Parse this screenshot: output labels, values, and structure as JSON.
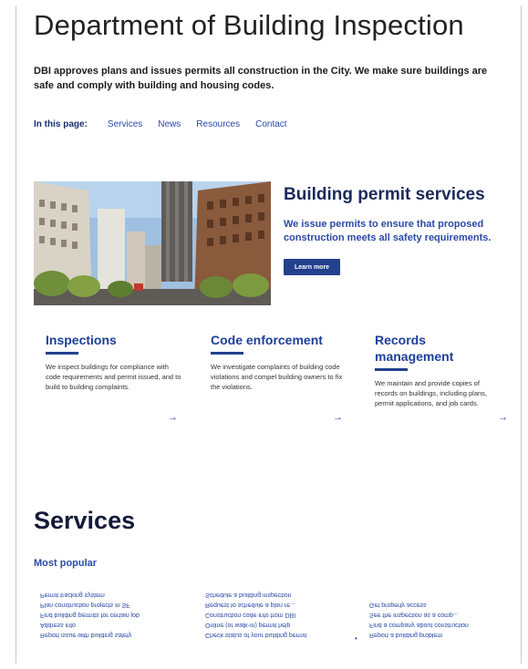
{
  "header": {
    "title": "Department of Building Inspection",
    "intro": "DBI approves plans and issues permits all construction in the City. We make sure buildings are safe and comply with building and housing codes."
  },
  "in_page": {
    "label": "In this page:",
    "links": [
      "Services",
      "News",
      "Resources",
      "Contact"
    ]
  },
  "hero": {
    "title": "Building permit services",
    "text": "We issue permits to ensure that proposed construction meets all safety requirements.",
    "button": "Learn more"
  },
  "cards": [
    {
      "title": "Inspections",
      "text": "We inspect buildings for compliance with code requirements and permit issued, and to build to building complaints.",
      "arrow": "→"
    },
    {
      "title": "Code enforcement",
      "text": "We investigate complaints of building code violations and compel building owners to fix the violations.",
      "arrow": "→"
    },
    {
      "title": "Records management",
      "text": "We maintain and provide copies of records on buildings, including plans, permit applications, and job cards.",
      "arrow": "→"
    }
  ],
  "services": {
    "title": "Services",
    "most_popular": "Most popular",
    "col1": [
      "Permit tracking system",
      "Plan construction projects in SF",
      "Find building permits for certain job",
      "Address info",
      "Report issue with building safety"
    ],
    "col2": [
      "Schedule a building inspection",
      "Request to schedule a plan re...",
      "Construction code info from DBI",
      "Online (or walk-in) permit help",
      "Check status of your building permit"
    ],
    "col3": [
      "Get property access",
      "See the inspection as a comp...",
      "Find a company about construction",
      "Report a building problem"
    ],
    "bullet": "•"
  }
}
